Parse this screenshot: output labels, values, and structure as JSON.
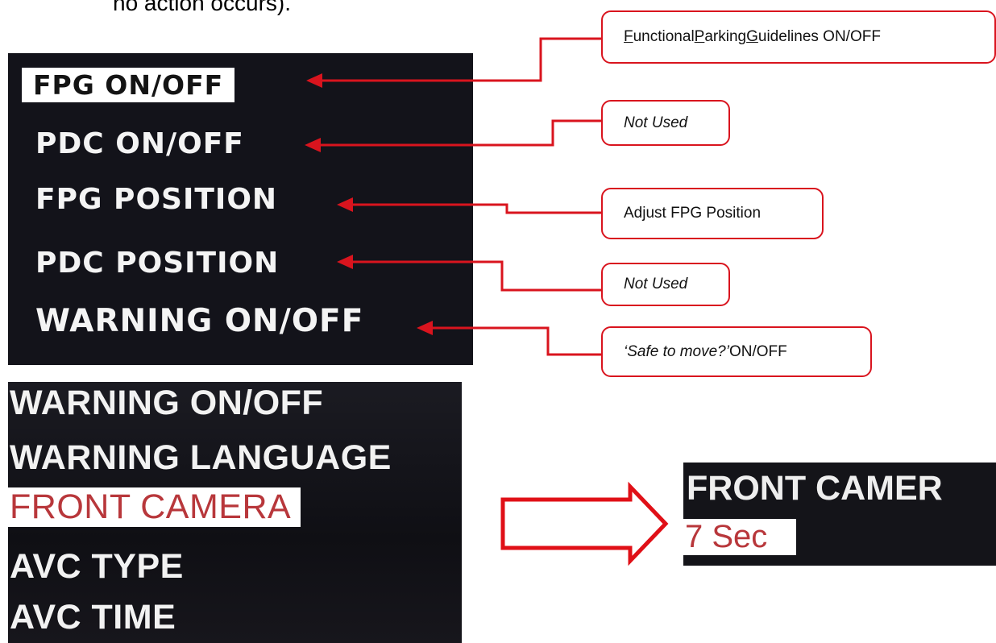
{
  "intro_text": "no action occurs).",
  "menu1": {
    "items": [
      "FPG ON/OFF",
      "PDC ON/OFF",
      "FPG POSITION",
      "PDC POSITION",
      "WARNING ON/OFF"
    ]
  },
  "callouts": {
    "c0": {
      "part1": "F",
      "part2": "unctional ",
      "part3": "P",
      "part4": "arking ",
      "part5": "G",
      "part6": "uidelines ON/OFF"
    },
    "c1": "Not Used",
    "c2": "Adjust FPG Position",
    "c3": "Not Used",
    "c4": {
      "italic": "‘Safe to move?’",
      "rest": " ON/OFF"
    }
  },
  "menu2": {
    "items": [
      "WARNING ON/OFF",
      "WARNING LANGUAGE",
      "FRONT CAMERA",
      "AVC TYPE",
      "AVC TIME"
    ]
  },
  "menu3": {
    "title": "FRONT CAMER",
    "value": "7 Sec"
  },
  "colors": {
    "accent": "#d9141e",
    "screen_bg": "#13131a",
    "selected_text": "#b8373b"
  }
}
